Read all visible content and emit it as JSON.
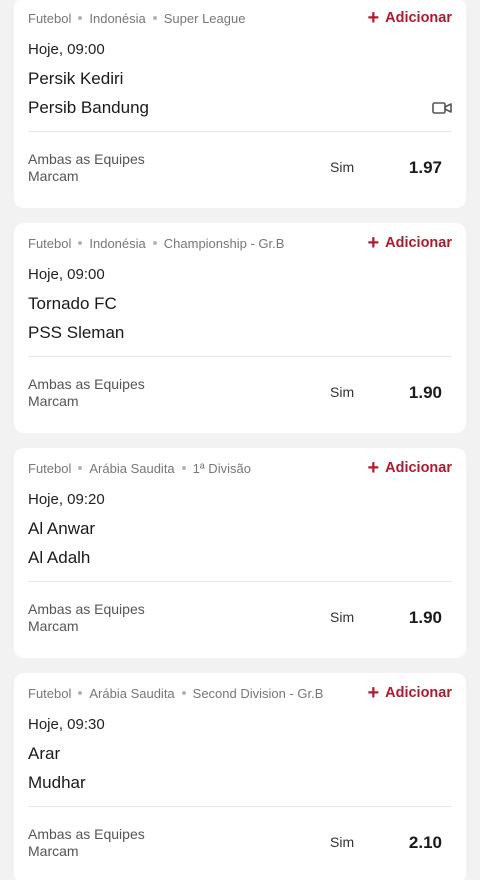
{
  "add_label": "Adicionar",
  "events": [
    {
      "sport": "Futebol",
      "country": "Indonésia",
      "league": "Super League",
      "time": "Hoje, 09:00",
      "home": "Persik Kediri",
      "away": "Persib Bandung",
      "has_video": true,
      "market": "Ambas as Equipes Marcam",
      "selection": "Sim",
      "odds": "1.97"
    },
    {
      "sport": "Futebol",
      "country": "Indonésia",
      "league": "Championship - Gr.B",
      "time": "Hoje, 09:00",
      "home": "Tornado FC",
      "away": "PSS Sleman",
      "has_video": false,
      "market": "Ambas as Equipes Marcam",
      "selection": "Sim",
      "odds": "1.90"
    },
    {
      "sport": "Futebol",
      "country": "Arábia Saudita",
      "league": "1ª Divisão",
      "time": "Hoje, 09:20",
      "home": "Al Anwar",
      "away": "Al Adalh",
      "has_video": false,
      "market": "Ambas as Equipes Marcam",
      "selection": "Sim",
      "odds": "1.90"
    },
    {
      "sport": "Futebol",
      "country": "Arábia Saudita",
      "league": "Second Division - Gr.B",
      "time": "Hoje, 09:30",
      "home": "Arar",
      "away": "Mudhar",
      "has_video": false,
      "market": "Ambas as Equipes Marcam",
      "selection": "Sim",
      "odds": "2.10"
    }
  ],
  "colors": {
    "accent": "#b0192e",
    "background": "#f2f2f2",
    "card": "#ffffff"
  }
}
